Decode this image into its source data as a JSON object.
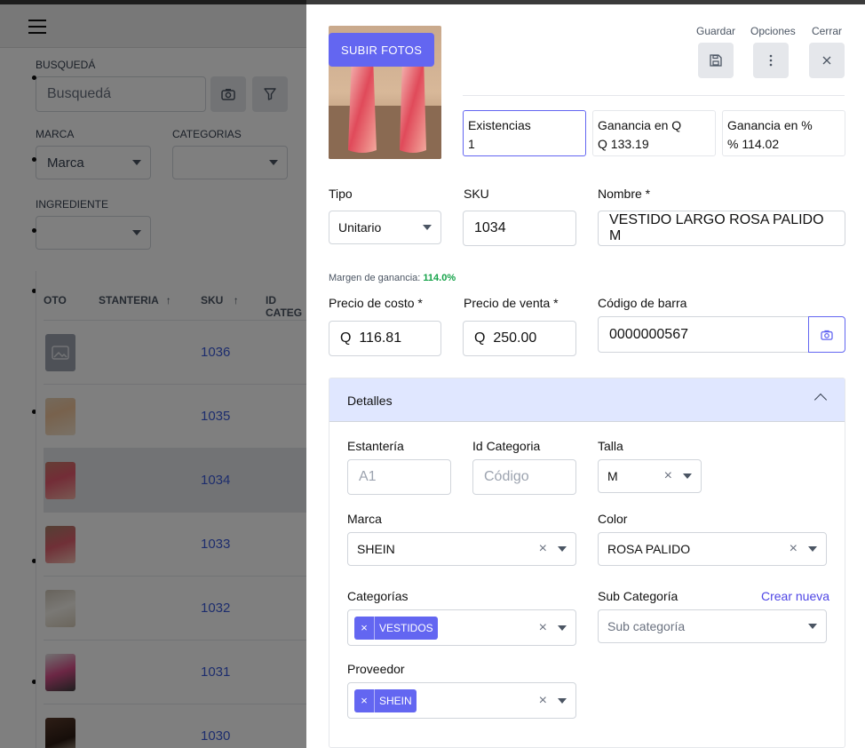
{
  "background": {
    "filters": {
      "search_label": "BUSQUEDÁ",
      "search_placeholder": "Busquedá",
      "brand_label": "MARCA",
      "brand_value": "Marca",
      "categories_label": "CATEGORIAS",
      "ingredient_label": "INGREDIENTE"
    },
    "table": {
      "headers": [
        "OTO",
        "STANTERIA",
        "SKU",
        "ID CATEG"
      ],
      "rows": [
        {
          "sku": "1036"
        },
        {
          "sku": "1035"
        },
        {
          "sku": "1034"
        },
        {
          "sku": "1033"
        },
        {
          "sku": "1032"
        },
        {
          "sku": "1031"
        },
        {
          "sku": "1030"
        }
      ]
    }
  },
  "drawer": {
    "upload_label": "SUBIR FOTOS",
    "actions": {
      "save_label": "Guardar",
      "options_label": "Opciones",
      "close_label": "Cerrar"
    },
    "stats": {
      "stock_label": "Existencias",
      "stock_value": "1",
      "profit_q_label": "Ganancia en Q",
      "profit_q_value": "Q 133.19",
      "profit_pct_label": "Ganancia en %",
      "profit_pct_value": "% 114.02"
    },
    "form": {
      "type_label": "Tipo",
      "type_value": "Unitario",
      "sku_label": "SKU",
      "sku_value": "1034",
      "name_label": "Nombre *",
      "name_value": "VESTIDO LARGO ROSA PALIDO M",
      "margin_label": "Margen de ganancia:",
      "margin_value": "114.0%",
      "cost_label": "Precio de costo *",
      "cost_value": "Q  116.81",
      "price_label": "Precio de venta *",
      "price_value": "Q  250.00",
      "barcode_label": "Código de barra",
      "barcode_value": "0000000567"
    },
    "details": {
      "title": "Detalles",
      "shelf_label": "Estantería",
      "shelf_placeholder": "A1",
      "category_id_label": "Id Categoria",
      "category_id_placeholder": "Código",
      "size_label": "Talla",
      "size_value": "M",
      "brand_label": "Marca",
      "brand_value": "SHEIN",
      "color_label": "Color",
      "color_value": "ROSA PALIDO",
      "categories_label": "Categorías",
      "categories_tag": "VESTIDOS",
      "subcategory_label": "Sub Categoría",
      "create_new_label": "Crear nueva",
      "subcategory_placeholder": "Sub categoría",
      "supplier_label": "Proveedor",
      "supplier_tag": "SHEIN"
    }
  },
  "colors": {
    "accent": "#6366f1",
    "accent_light": "#e0e7ff",
    "margin_green": "#16a34a",
    "link": "#3b5bdb"
  }
}
